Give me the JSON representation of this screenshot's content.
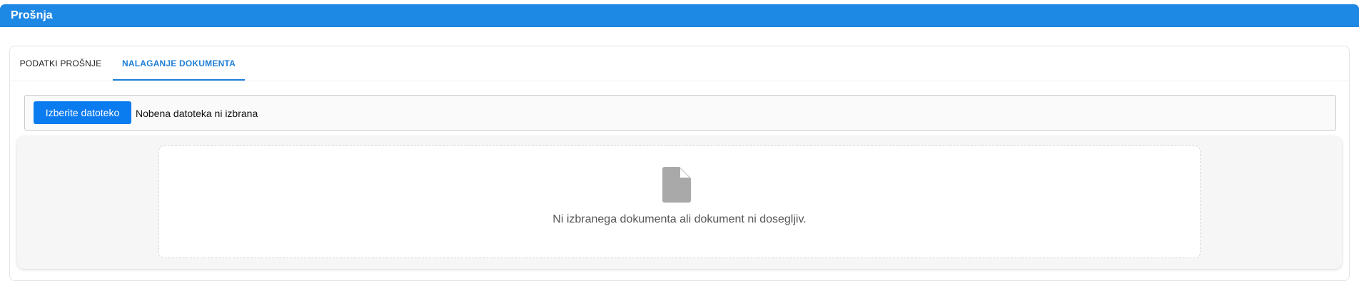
{
  "panel": {
    "title": "Prošnja",
    "accent_color": "#1e88e5"
  },
  "tabs": [
    {
      "label": "PODATKI PROŠNJE",
      "active": false
    },
    {
      "label": "NALAGANJE DOKUMENTA",
      "active": true
    }
  ],
  "upload": {
    "button_label": "Izberite datoteko",
    "status_text": "Nobena datoteka ni izbrana"
  },
  "viewer": {
    "icon": "document-icon",
    "empty_message": "Ni izbranega dokumenta ali dokument ni dosegljiv."
  }
}
